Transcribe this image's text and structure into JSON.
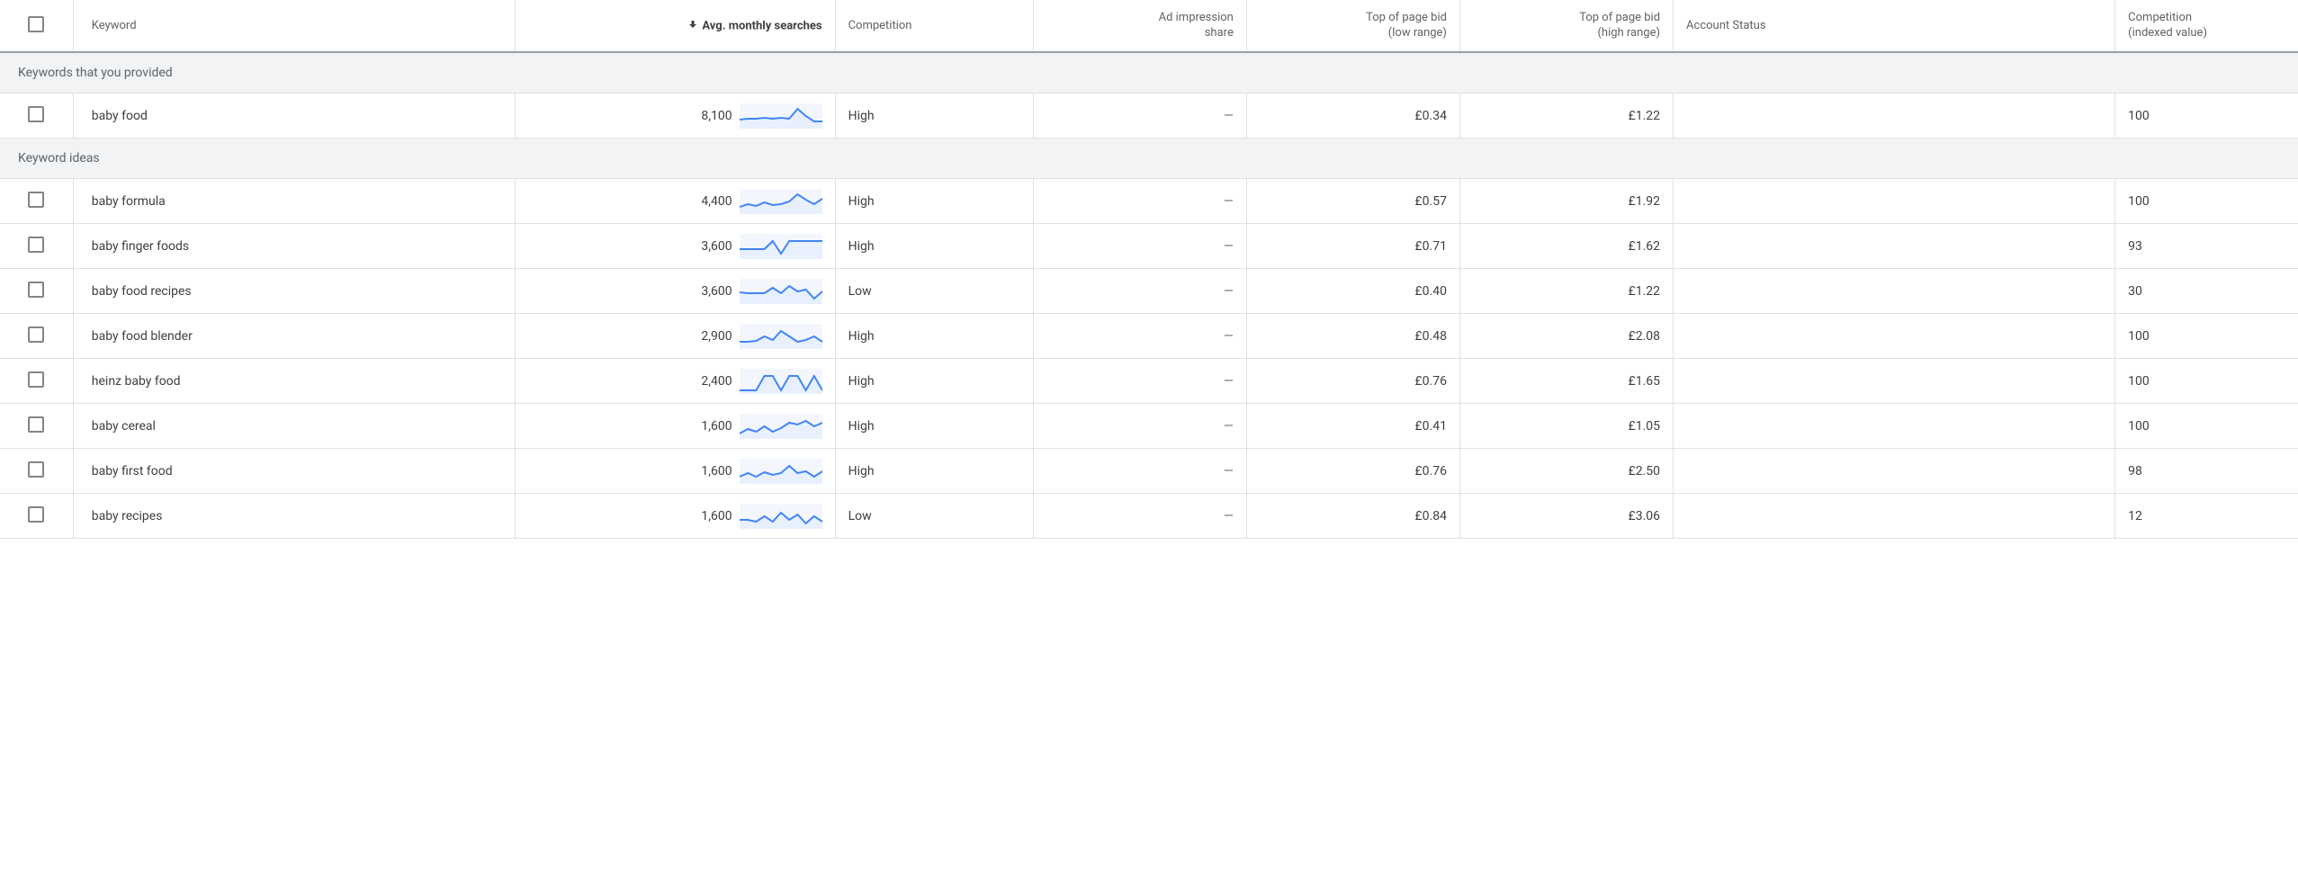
{
  "headers": {
    "keyword": "Keyword",
    "searches": "Avg. monthly searches",
    "competition": "Competition",
    "impression1": "Ad impression",
    "impression2": "share",
    "low1": "Top of page bid",
    "low2": "(low range)",
    "high1": "Top of page bid",
    "high2": "(high range)",
    "status": "Account Status",
    "index1": "Competition",
    "index2": "(indexed value)"
  },
  "sections": {
    "provided": "Keywords that you provided",
    "ideas": "Keyword ideas"
  },
  "rows_provided": [
    {
      "keyword": "baby food",
      "searches": "8,100",
      "competition": "High",
      "impression": "—",
      "low": "£0.34",
      "high": "£1.22",
      "status": "",
      "index": "100",
      "spark": [
        18,
        17,
        17,
        16,
        17,
        16,
        17,
        6,
        14,
        20,
        20
      ]
    }
  ],
  "rows_ideas": [
    {
      "keyword": "baby formula",
      "searches": "4,400",
      "competition": "High",
      "impression": "—",
      "low": "£0.57",
      "high": "£1.92",
      "status": "",
      "index": "100",
      "spark": [
        20,
        17,
        19,
        15,
        18,
        17,
        14,
        6,
        12,
        17,
        11
      ]
    },
    {
      "keyword": "baby finger foods",
      "searches": "3,600",
      "competition": "High",
      "impression": "—",
      "low": "£0.71",
      "high": "£1.62",
      "status": "",
      "index": "93",
      "spark": [
        17,
        17,
        17,
        17,
        8,
        22,
        8,
        8,
        8,
        8,
        8
      ]
    },
    {
      "keyword": "baby food recipes",
      "searches": "3,600",
      "competition": "Low",
      "impression": "—",
      "low": "£0.40",
      "high": "£1.22",
      "status": "",
      "index": "30",
      "spark": [
        15,
        16,
        16,
        16,
        10,
        16,
        8,
        14,
        12,
        22,
        14
      ]
    },
    {
      "keyword": "baby food blender",
      "searches": "2,900",
      "competition": "High",
      "impression": "—",
      "low": "£0.48",
      "high": "£2.08",
      "status": "",
      "index": "100",
      "spark": [
        20,
        20,
        19,
        14,
        18,
        8,
        14,
        20,
        18,
        14,
        20
      ]
    },
    {
      "keyword": "heinz baby food",
      "searches": "2,400",
      "competition": "High",
      "impression": "—",
      "low": "£0.76",
      "high": "£1.65",
      "status": "",
      "index": "100",
      "spark": [
        24,
        24,
        24,
        8,
        8,
        24,
        8,
        8,
        24,
        8,
        24
      ]
    },
    {
      "keyword": "baby cereal",
      "searches": "1,600",
      "competition": "High",
      "impression": "—",
      "low": "£0.41",
      "high": "£1.05",
      "status": "",
      "index": "100",
      "spark": [
        22,
        17,
        20,
        14,
        20,
        16,
        10,
        12,
        8,
        14,
        10
      ]
    },
    {
      "keyword": "baby first food",
      "searches": "1,600",
      "competition": "High",
      "impression": "—",
      "low": "£0.76",
      "high": "£2.50",
      "status": "",
      "index": "98",
      "spark": [
        20,
        16,
        20,
        15,
        18,
        16,
        8,
        16,
        14,
        20,
        14
      ]
    },
    {
      "keyword": "baby recipes",
      "searches": "1,600",
      "competition": "Low",
      "impression": "—",
      "low": "£0.84",
      "high": "£3.06",
      "status": "",
      "index": "12",
      "spark": [
        18,
        18,
        20,
        14,
        20,
        10,
        18,
        12,
        22,
        14,
        20
      ]
    }
  ]
}
